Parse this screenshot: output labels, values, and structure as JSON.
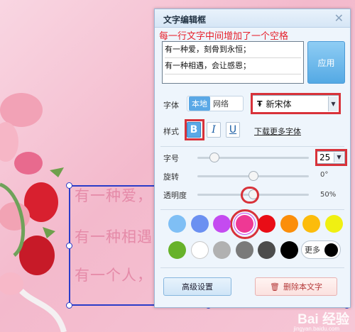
{
  "canvas": {
    "lines": [
      "有一种爱，",
      "有一种相遇",
      "有一个人，"
    ]
  },
  "watermark": {
    "brand": "Bai 经验",
    "sub": "jingyan.baidu.com"
  },
  "panel": {
    "title": "文字编辑框",
    "annotation": "每一行文字中间增加了一个空格",
    "textarea_lines": [
      "有一种爱，刻骨到永恒；",
      "有一种相遇，会让感恩；"
    ],
    "apply_label": "应用",
    "font_label": "字体",
    "source_tabs": [
      "本地",
      "网络"
    ],
    "font_selected": "新宋体",
    "style_label": "样式",
    "style_buttons": [
      "B",
      "I",
      "U"
    ],
    "download_link": "下载更多字体",
    "size_label": "字号",
    "size_value": "25",
    "rotate_label": "旋转",
    "rotate_value": "0°",
    "opacity_label": "透明度",
    "opacity_value": "50%",
    "sliders": {
      "size_fraction": 0.12,
      "rotate_fraction": 0.5,
      "opacity_fraction": 0.5
    },
    "swatches_row1": [
      "#7fbff5",
      "#6b90f1",
      "#c44bf0",
      "#ee3994",
      "#e90d16",
      "#fb8e0b",
      "#fcbc0c",
      "#f0f012"
    ],
    "swatches_row2": [
      "#67b22a",
      "#ffffff",
      "#b1b1b1",
      "#7a7a7a",
      "#4c4c4c",
      "#000000"
    ],
    "more_label": "更多",
    "advanced_label": "高级设置",
    "delete_label": "删除本文字"
  }
}
